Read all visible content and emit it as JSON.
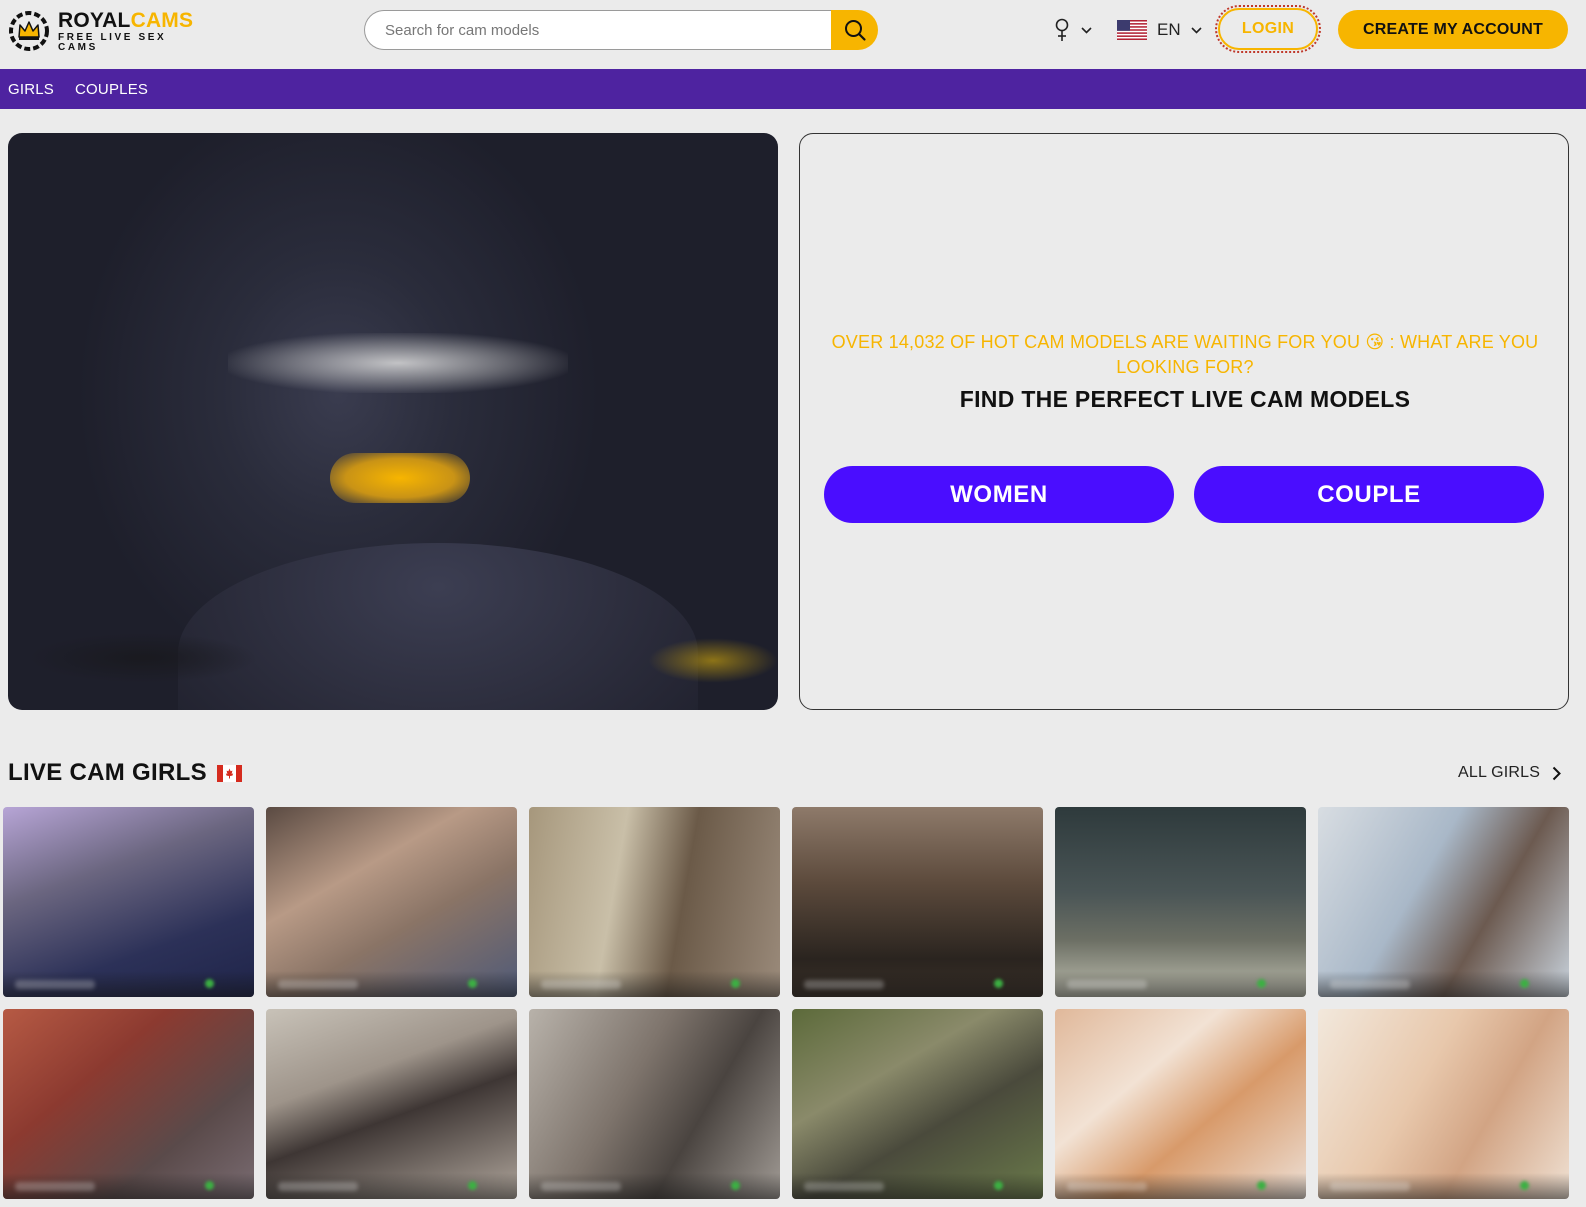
{
  "brand": {
    "name_part1": "ROYAL",
    "name_part2": "CAMS",
    "tagline": "FREE LIVE SEX CAMS",
    "accent_color": "#f7b500",
    "logo_icon": "crown-icon"
  },
  "search": {
    "placeholder": "Search for cam models",
    "value": "",
    "icon": "search-icon"
  },
  "header": {
    "gender_icon": "female-symbol-icon",
    "language_label": "EN",
    "language_flag": "us-flag-icon",
    "login_label": "LOGIN",
    "create_account_label": "CREATE MY ACCOUNT"
  },
  "nav": {
    "bar_color": "#4e23a0",
    "items": [
      {
        "label": "GIRLS"
      },
      {
        "label": "COUPLES"
      }
    ]
  },
  "hero": {
    "subtitle": "OVER 14,032 OF HOT CAM MODELS ARE WAITING FOR YOU 😘 : WHAT ARE YOU LOOKING FOR?",
    "title": "FIND THE PERFECT LIVE CAM MODELS",
    "buttons": [
      {
        "label": "WOMEN"
      },
      {
        "label": "COUPLE"
      }
    ],
    "button_color": "#4a0dff"
  },
  "section": {
    "title": "LIVE CAM GIRLS",
    "flag": "canada-flag-icon",
    "all_link_label": "ALL GIRLS"
  },
  "tiles": [
    {
      "bg": "linear-gradient(160deg,#b7a5d6 0%,#6b6680 35%,#2c3158 70%,#1f2449 100%)"
    },
    {
      "bg": "linear-gradient(150deg,#5a4a42 0%,#b89a86 35%,#8a7466 60%,#4f5a78 100%)"
    },
    {
      "bg": "linear-gradient(100deg,#a6977c 0%,#c9bfa8 35%,#6b5a48 60%,#9a8a7a 100%)"
    },
    {
      "bg": "linear-gradient(180deg,#8e7a6a 0%,#5c4a3c 40%,#2a241f 80%,#3a3028 100%)"
    },
    {
      "bg": "linear-gradient(180deg,#2e3a3c 0%,#4a5556 45%,#6c6f64 70%,#bfbfb0 100%)"
    },
    {
      "bg": "linear-gradient(120deg,#d8dde2 0%,#a9b8c8 40%,#6c5a50 65%,#c8d2dc 100%)"
    },
    {
      "bg": "linear-gradient(140deg,#b65a44 0%,#8c3a30 35%,#5a4a4a 70%,#7a6c72 100%)"
    },
    {
      "bg": "linear-gradient(160deg,#c8c2b8 0%,#9e948a 35%,#3e3634 55%,#b0a69c 100%)"
    },
    {
      "bg": "linear-gradient(120deg,#b8b2aa 0%,#7e746c 40%,#4a4440 65%,#a09a94 100%)"
    },
    {
      "bg": "linear-gradient(150deg,#5c6a3a 0%,#8a8a6a 35%,#4a4a3c 60%,#6a7a4a 100%)"
    },
    {
      "bg": "linear-gradient(140deg,#e0b89a 0%,#f2e2d4 35%,#d89a6a 60%,#ede0d6 100%)"
    },
    {
      "bg": "linear-gradient(120deg,#f2e8dc 0%,#e8c8ac 40%,#d2a484 65%,#efe0d2 100%)"
    }
  ]
}
